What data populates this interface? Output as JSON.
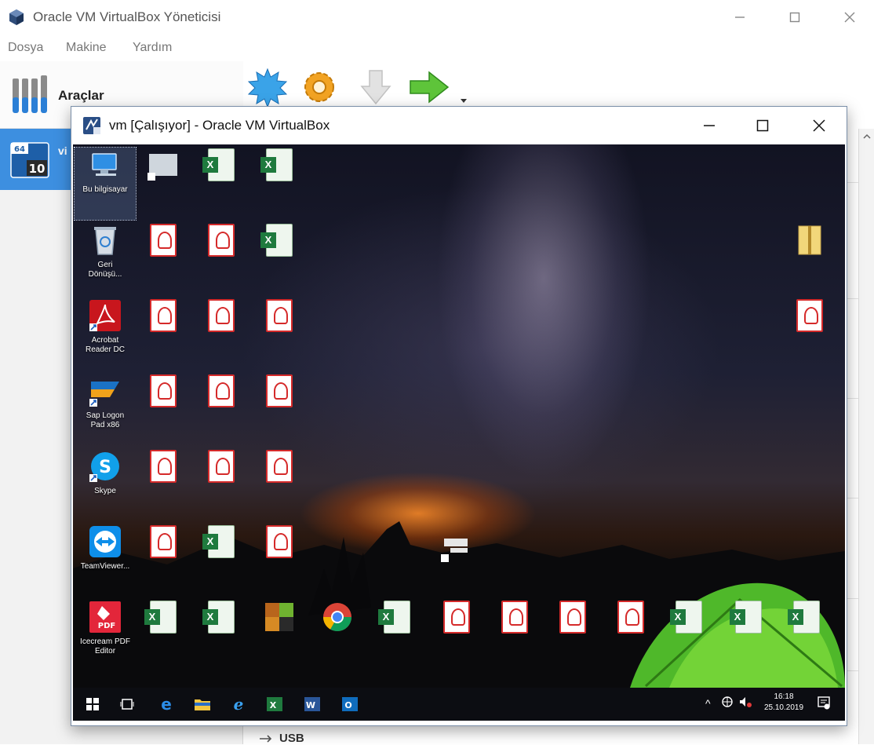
{
  "host": {
    "title": "Oracle VM VirtualBox Yöneticisi",
    "menu": [
      "Dosya",
      "Makine",
      "Yardım"
    ],
    "tools_label": "Araçlar",
    "vm_row_name": "vi",
    "vm_badge_bits": "64",
    "vm_badge_os": "10",
    "usb_label": "USB"
  },
  "vm": {
    "title": "vm [Çalışıyor] - Oracle VM VirtualBox",
    "desktop": {
      "icons": [
        {
          "label": "Bu bilgisayar",
          "type": "computer"
        },
        {
          "label": "Geri\nDönüşü...",
          "type": "recycle"
        },
        {
          "label": "Acrobat\nReader DC",
          "type": "acrobat"
        },
        {
          "label": "Sap Logon\nPad x86",
          "type": "sap"
        },
        {
          "label": "Skype",
          "type": "skype"
        },
        {
          "label": "TeamViewer...",
          "type": "teamviewer"
        },
        {
          "label": "Icecream PDF\nEditor",
          "type": "icecream"
        }
      ],
      "clock_time": "16:18",
      "clock_date": "25.10.2019"
    }
  },
  "colors": {
    "selection_blue": "#3d8fe0",
    "pdf_red": "#d52a2a",
    "excel_green": "#1f7a3e",
    "taskbar": "#0c0d12"
  }
}
